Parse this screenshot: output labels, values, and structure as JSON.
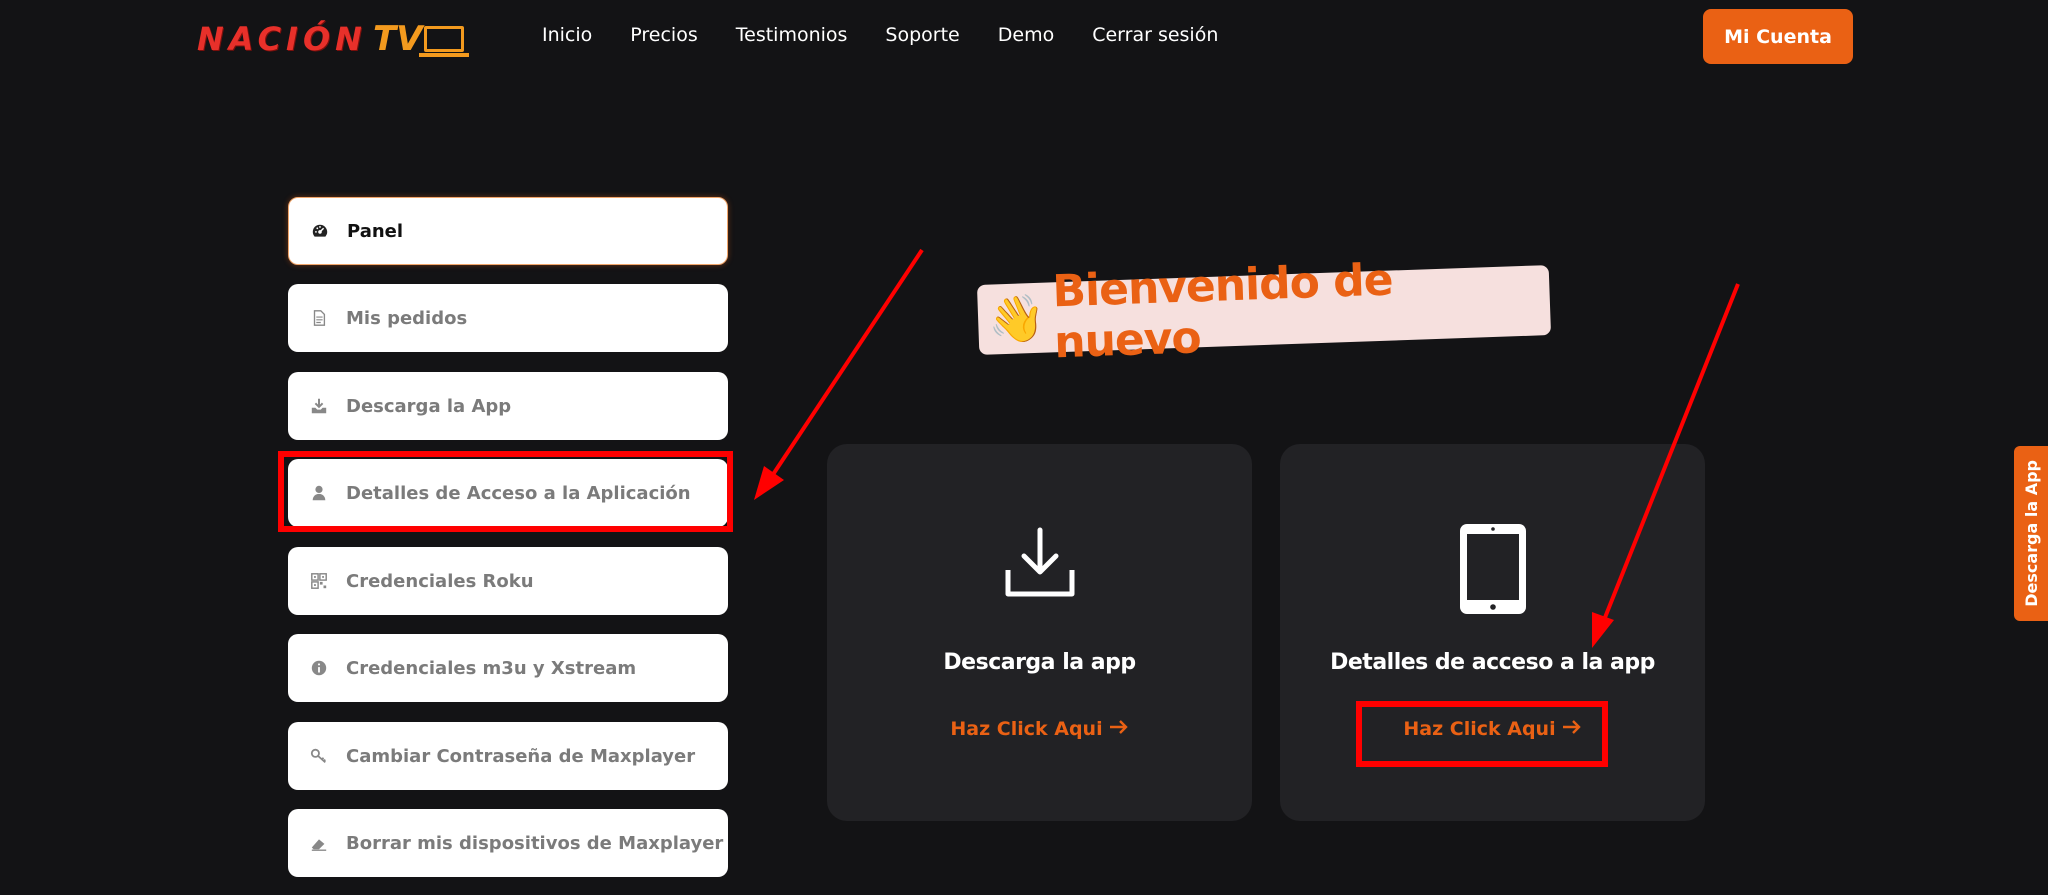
{
  "brand": {
    "name": "NACIÓN",
    "tv": "TV",
    "logo_color": "#e8302a",
    "logo_accent": "#f39a1e"
  },
  "nav": {
    "items": [
      "Inicio",
      "Precios",
      "Testimonios",
      "Soporte",
      "Demo",
      "Cerrar sesión"
    ],
    "account_label": "Mi Cuenta"
  },
  "sidebar": {
    "items": [
      {
        "label": "Panel",
        "icon": "dashboard-icon",
        "active": true
      },
      {
        "label": "Mis pedidos",
        "icon": "document-icon",
        "active": false
      },
      {
        "label": "Descarga la App",
        "icon": "download-icon",
        "active": false
      },
      {
        "label": "Detalles de Acceso a la Aplicación",
        "icon": "user-icon",
        "active": false
      },
      {
        "label": "Credenciales Roku",
        "icon": "qr-code-icon",
        "active": false
      },
      {
        "label": "Credenciales m3u y Xstream",
        "icon": "info-icon",
        "active": false
      },
      {
        "label": "Cambiar Contraseña de Maxplayer",
        "icon": "key-icon",
        "active": false
      },
      {
        "label": "Borrar mis dispositivos de Maxplayer",
        "icon": "eraser-icon",
        "active": false
      }
    ]
  },
  "welcome": {
    "emoji": "👋",
    "text": "Bienvenido de nuevo"
  },
  "cards": [
    {
      "title": "Descarga la app",
      "link": "Haz Click Aqui",
      "icon": "download-tray-icon"
    },
    {
      "title": "Detalles de acceso a la app",
      "link": "Haz Click Aqui",
      "icon": "tablet-icon"
    }
  ],
  "side_tab": {
    "label": "Descarga la App"
  },
  "colors": {
    "accent": "#ea6114",
    "background": "#131315",
    "card": "#222225",
    "annotation": "#ff0000"
  }
}
